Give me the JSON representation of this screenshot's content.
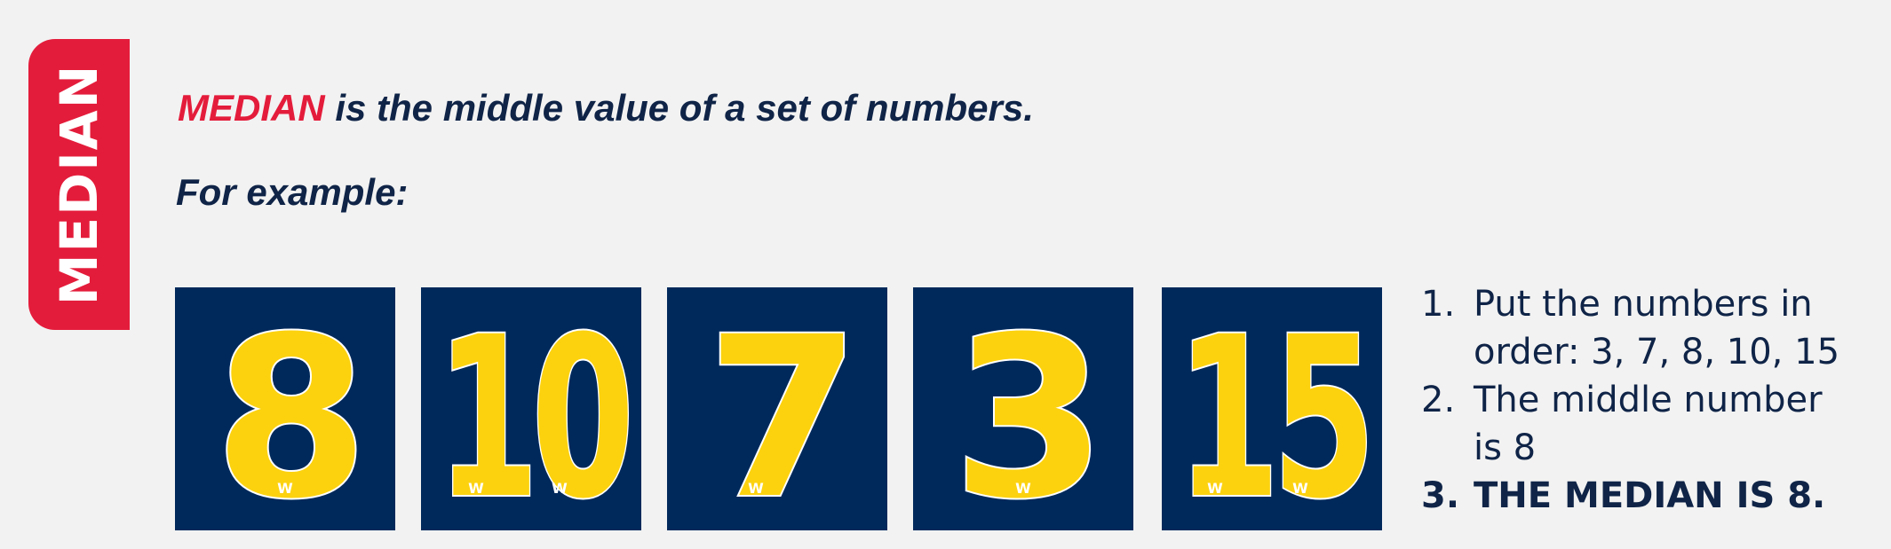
{
  "side_tab": {
    "label": "MEDIAN"
  },
  "headline": {
    "keyword": "MEDIAN",
    "rest": " is the middle value of a set of numbers."
  },
  "subhead": "For example:",
  "cards": [
    "8",
    "10",
    "7",
    "3",
    "15"
  ],
  "colors": {
    "navy": "#00295b",
    "gold": "#fcd20f",
    "red": "#e41c3b",
    "text": "#0f2447",
    "background": "#f2f2f2"
  },
  "steps": [
    {
      "number": "1.",
      "lines": [
        "Put the numbers in",
        "order: 3, 7, 8, 10, 15"
      ]
    },
    {
      "number": "2.",
      "lines": [
        "The middle number",
        "is 8"
      ]
    },
    {
      "number": "3.",
      "lines": [
        "THE MEDIAN IS 8."
      ]
    }
  ]
}
